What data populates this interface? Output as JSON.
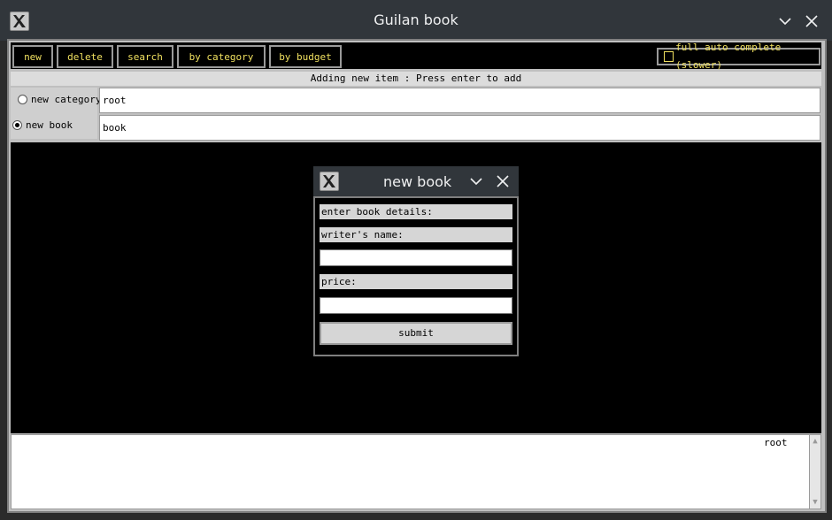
{
  "window": {
    "title": "Guilan book",
    "minimize_glyph": "⌵",
    "close_glyph": "✕"
  },
  "toolbar": {
    "new_label": "new",
    "delete_label": "delete",
    "search_label": "search",
    "by_category_label": "by category",
    "by_budget_label": "by budget",
    "autocomplete_label": "full auto complete (slower)",
    "autocomplete_checked": false
  },
  "status": {
    "message": "Adding new item : Press enter to add"
  },
  "item_type": {
    "options": [
      {
        "label": "new category",
        "selected": false
      },
      {
        "label": "new book",
        "selected": true
      }
    ]
  },
  "fields": {
    "category_value": "root",
    "name_value": "book"
  },
  "output": {
    "text": "root"
  },
  "dialog": {
    "title": "new book",
    "minimize_glyph": "⌵",
    "close_glyph": "✕",
    "heading": "enter book details:",
    "writer_label": "writer's name:",
    "writer_value": "",
    "price_label": "price:",
    "price_value": "",
    "submit_label": "submit"
  },
  "colors": {
    "titlebar": "#31363b",
    "toolbar_text": "#f0e060",
    "background": "#000000"
  }
}
